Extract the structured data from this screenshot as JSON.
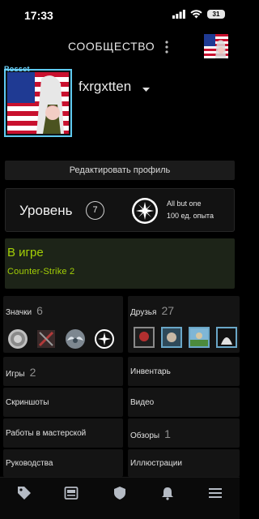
{
  "status_bar": {
    "time": "17:33",
    "battery": "31"
  },
  "header": {
    "title": "СООБЩЕСТВО"
  },
  "profile": {
    "username": "fxrgxtten",
    "frame_text": "Rosset",
    "edit_button": "Редактировать профиль"
  },
  "level": {
    "label": "Уровень",
    "number": "7",
    "badge_name": "All but one",
    "badge_xp": "100 ед. опыта"
  },
  "in_game": {
    "status": "В игре",
    "game": "Counter-Strike 2"
  },
  "tiles": {
    "badges": {
      "label": "Значки",
      "count": "6"
    },
    "friends": {
      "label": "Друзья",
      "count": "27"
    },
    "games": {
      "label": "Игры",
      "count": "2"
    },
    "inventory": {
      "label": "Инвентарь"
    },
    "screenshots": {
      "label": "Скриншоты"
    },
    "videos": {
      "label": "Видео"
    },
    "workshop": {
      "label": "Работы в мастерской"
    },
    "reviews": {
      "label": "Обзоры",
      "count": "1"
    },
    "guides": {
      "label": "Руководства"
    },
    "artwork": {
      "label": "Иллюстрации"
    }
  },
  "bottom_nav": [
    "tag-icon",
    "news-icon",
    "shield-icon",
    "bell-icon",
    "menu-icon"
  ],
  "colors": {
    "accent_green": "#a3cf06",
    "frame_blue": "#5ec9ef",
    "background": "#000000",
    "tile": "#141414"
  }
}
